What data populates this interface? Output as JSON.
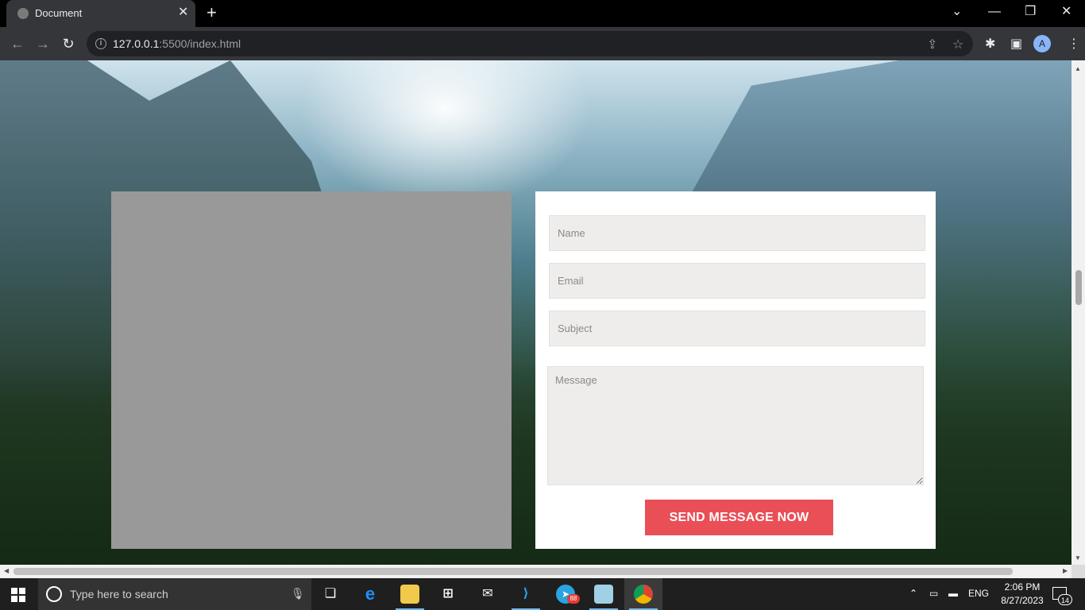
{
  "browser": {
    "tab_title": "Document",
    "url_host": "127.0.0.1",
    "url_path": ":5500/index.html",
    "avatar_letter": "A"
  },
  "form": {
    "name_placeholder": "Name",
    "email_placeholder": "Email",
    "subject_placeholder": "Subject",
    "message_placeholder": "Message",
    "submit_label": "SEND MESSAGE NOW"
  },
  "taskbar": {
    "search_placeholder": "Type here to search",
    "telegram_badge": "88",
    "language": "ENG",
    "time": "2:06 PM",
    "date": "8/27/2023",
    "notification_count": "14"
  },
  "colors": {
    "accent_button": "#e94f57",
    "left_panel": "#999999",
    "field_bg": "#eeedeb"
  }
}
